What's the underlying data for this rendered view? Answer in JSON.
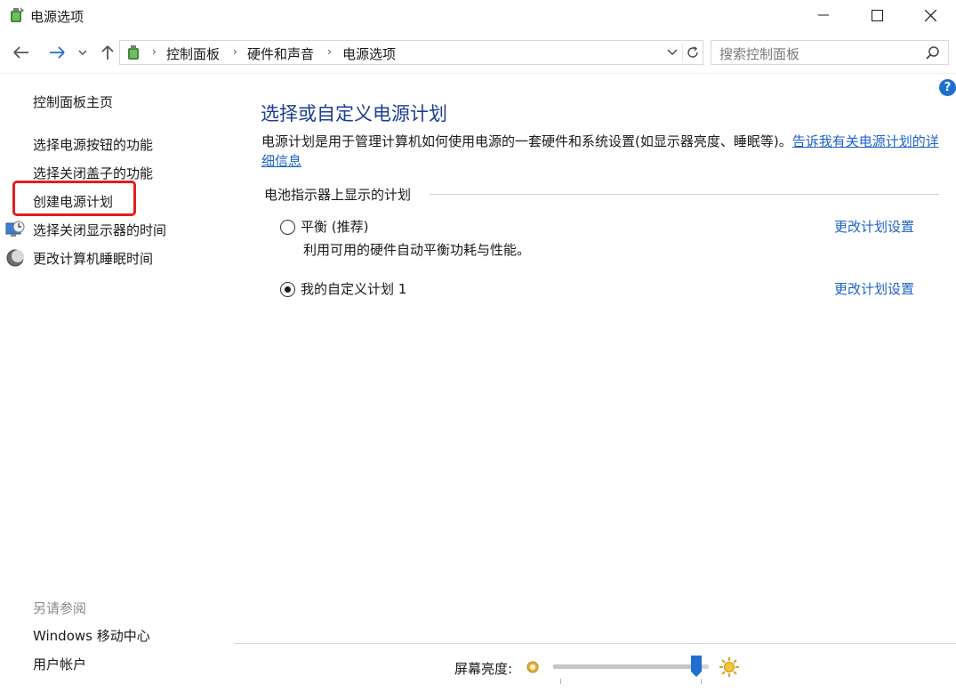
{
  "window": {
    "title": "电源选项",
    "minimize_icon": "minimize-icon",
    "maximize_icon": "maximize-icon",
    "close_icon": "close-icon"
  },
  "address_bar": {
    "breadcrumbs": [
      "控制面板",
      "硬件和声音",
      "电源选项"
    ],
    "search_placeholder": "搜索控制面板"
  },
  "sidebar": {
    "home_link": "控制面板主页",
    "links": [
      {
        "label": "选择电源按钮的功能",
        "icon": ""
      },
      {
        "label": "选择关闭盖子的功能",
        "icon": ""
      },
      {
        "label": "创建电源计划",
        "icon": "",
        "highlighted": true
      },
      {
        "label": "选择关闭显示器的时间",
        "icon": "monitor-clock-icon"
      },
      {
        "label": "更改计算机睡眠时间",
        "icon": "moon-icon"
      }
    ],
    "see_also_heading": "另请参阅",
    "see_also_links": [
      "Windows 移动中心",
      "用户帐户"
    ]
  },
  "main": {
    "help_label": "?",
    "title": "选择或自定义电源计划",
    "description": "电源计划是用于管理计算机如何使用电源的一套硬件和系统设置(如显示器亮度、睡眠等)。",
    "description_link": "告诉我有关电源计划的详细信息",
    "section_label": "电池指示器上显示的计划",
    "plans": [
      {
        "name": "平衡 (推荐)",
        "description": "利用可用的硬件自动平衡功耗与性能。",
        "selected": false,
        "link": "更改计划设置"
      },
      {
        "name": "我的自定义计划 1",
        "description": "",
        "selected": true,
        "link": "更改计划设置"
      }
    ]
  },
  "brightness": {
    "label": "屏幕亮度:",
    "level_percent": 92,
    "colors": {
      "accent": "#1f6fd1",
      "link": "#1e63c8",
      "title": "#1c3f94",
      "highlight": "#e0201b"
    }
  }
}
